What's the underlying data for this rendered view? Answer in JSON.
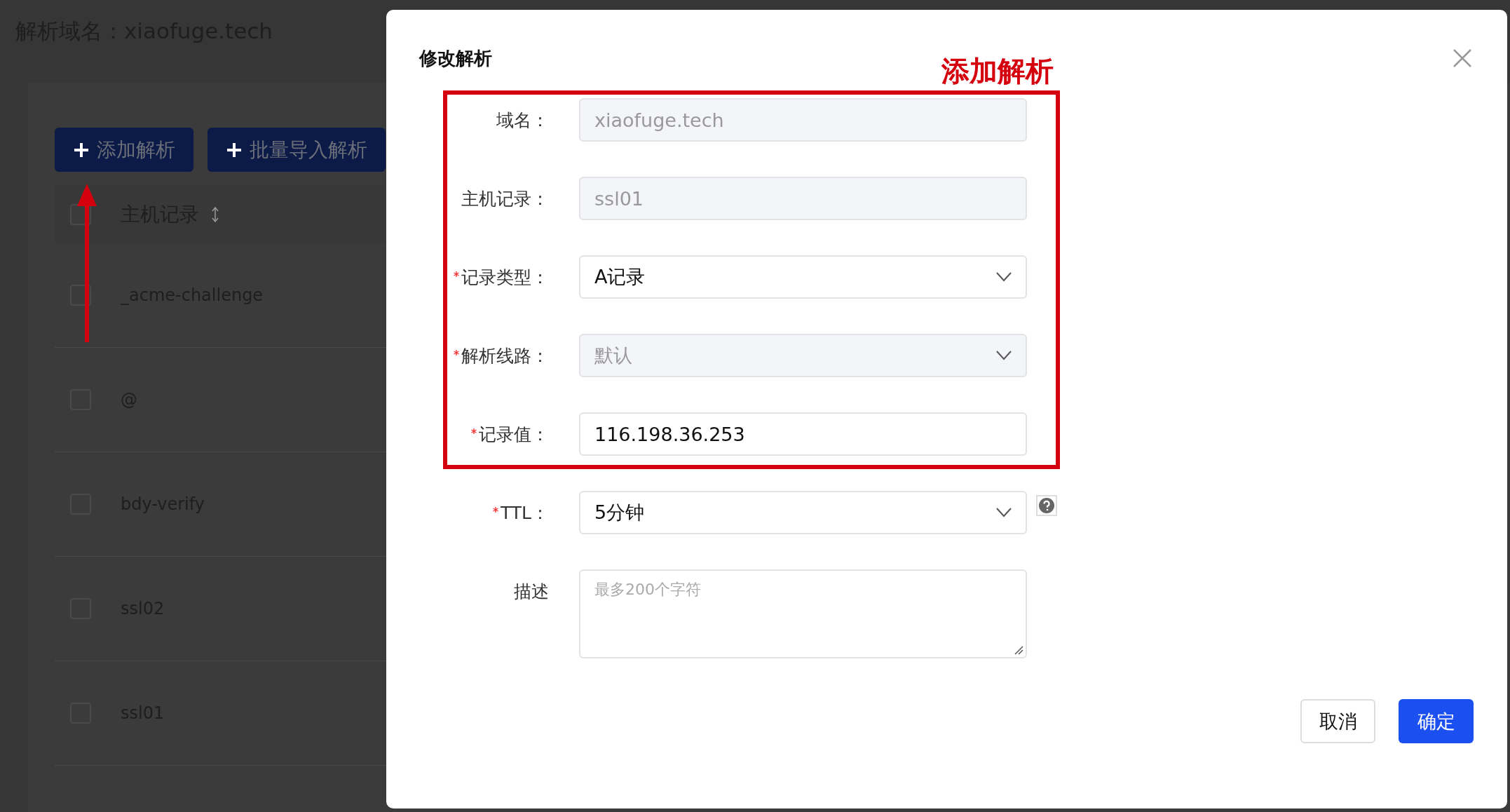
{
  "page": {
    "title": "解析域名：xiaofuge.tech",
    "buttons": [
      {
        "label": "添加解析"
      },
      {
        "label": "批量导入解析"
      }
    ],
    "table": {
      "header_checked": false,
      "columns": [
        {
          "label": "主机记录"
        }
      ],
      "rows": [
        {
          "host": "_acme-challenge",
          "checked": false
        },
        {
          "host": "@",
          "checked": false
        },
        {
          "host": "bdy-verify",
          "checked": false
        },
        {
          "host": "ssl02",
          "checked": false
        },
        {
          "host": "ssl01",
          "checked": false
        }
      ]
    }
  },
  "dialog": {
    "title": "修改解析",
    "fields": [
      {
        "label": "域名：",
        "kind": "input",
        "required": false,
        "disabled": true,
        "value": "xiaofuge.tech"
      },
      {
        "label": "主机记录：",
        "kind": "input",
        "required": false,
        "disabled": true,
        "value": "ssl01"
      },
      {
        "label": "记录类型：",
        "kind": "select",
        "required": true,
        "disabled": false,
        "value": "A记录"
      },
      {
        "label": "解析线路：",
        "kind": "select",
        "required": true,
        "disabled": true,
        "value": "默认"
      },
      {
        "label": "记录值：",
        "kind": "input",
        "required": true,
        "disabled": false,
        "value": "116.198.36.253"
      },
      {
        "label": "TTL：",
        "kind": "select",
        "required": true,
        "disabled": false,
        "value": "5分钟",
        "help": true
      },
      {
        "label": "描述",
        "kind": "textarea",
        "required": false,
        "placeholder": "最多200个字符"
      }
    ],
    "buttons": [
      {
        "label": "取消",
        "kind": "secondary"
      },
      {
        "label": "确定",
        "kind": "primary"
      }
    ]
  },
  "annotation": {
    "text": "添加解析"
  }
}
